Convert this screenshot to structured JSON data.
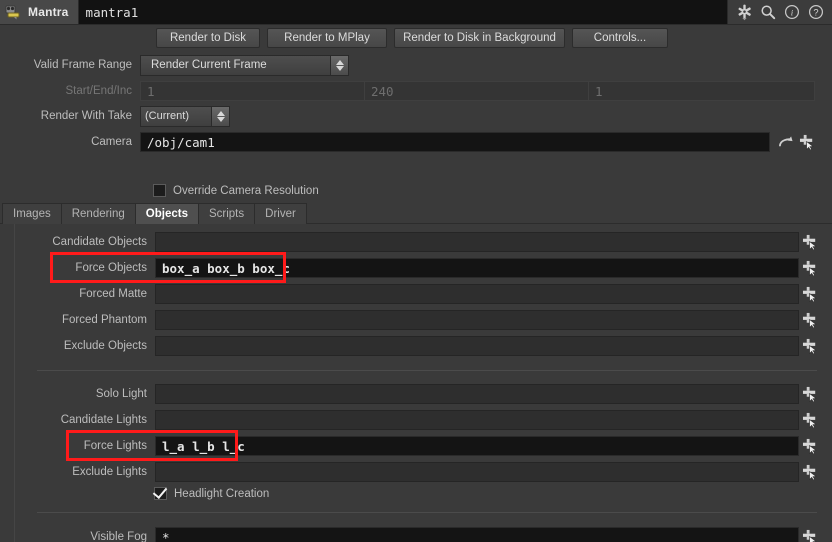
{
  "titlebar": {
    "node_type_label": "Mantra",
    "node_path": "mantra1",
    "icons": [
      {
        "name": "gear-icon",
        "glyph": "⚙"
      },
      {
        "name": "search-icon",
        "glyph": "⌕"
      },
      {
        "name": "info-icon",
        "glyph": "ⓘ"
      },
      {
        "name": "help-icon",
        "glyph": "?"
      }
    ]
  },
  "actions": {
    "render_to_disk": "Render to Disk",
    "render_to_mplay": "Render to MPlay",
    "render_to_disk_background": "Render to Disk in Background",
    "controls": "Controls..."
  },
  "params": {
    "valid_frame_range": {
      "label": "Valid Frame Range",
      "value": "Render Current Frame"
    },
    "start_end_inc": {
      "label": "Start/End/Inc",
      "start": "1",
      "end": "240",
      "inc": "1",
      "disabled": true
    },
    "render_with_take": {
      "label": "Render With Take",
      "value": "(Current)"
    },
    "camera": {
      "label": "Camera",
      "value": "/obj/cam1"
    },
    "override_camera_resolution": {
      "label": "Override Camera Resolution",
      "checked": false
    }
  },
  "tabs": [
    {
      "label": "Images",
      "active": false
    },
    {
      "label": "Rendering",
      "active": false
    },
    {
      "label": "Objects",
      "active": true
    },
    {
      "label": "Scripts",
      "active": false
    },
    {
      "label": "Driver",
      "active": false
    }
  ],
  "objects_tab": {
    "object_rows": [
      {
        "label": "Candidate Objects",
        "value": "",
        "highlighted": false
      },
      {
        "label": "Force Objects",
        "value": "box_a box_b box_c",
        "highlighted": true
      },
      {
        "label": "Forced Matte",
        "value": "",
        "highlighted": false
      },
      {
        "label": "Forced Phantom",
        "value": "",
        "highlighted": false
      },
      {
        "label": "Exclude Objects",
        "value": "",
        "highlighted": false
      }
    ],
    "light_rows": [
      {
        "label": "Solo Light",
        "value": "",
        "highlighted": false
      },
      {
        "label": "Candidate Lights",
        "value": "",
        "highlighted": false
      },
      {
        "label": "Force Lights",
        "value": "l_a l_b l_c",
        "highlighted": true
      },
      {
        "label": "Exclude Lights",
        "value": "",
        "highlighted": false
      }
    ],
    "headlight_creation": {
      "label": "Headlight Creation",
      "checked": true
    },
    "fog_rows": [
      {
        "label": "Visible Fog",
        "value": "*",
        "highlighted": false
      }
    ]
  },
  "colors": {
    "highlight": "#ff1a1a",
    "panel_bg": "#3a3a3a",
    "field_bg": "#141414",
    "accent_tab": "#4f4f4f"
  }
}
